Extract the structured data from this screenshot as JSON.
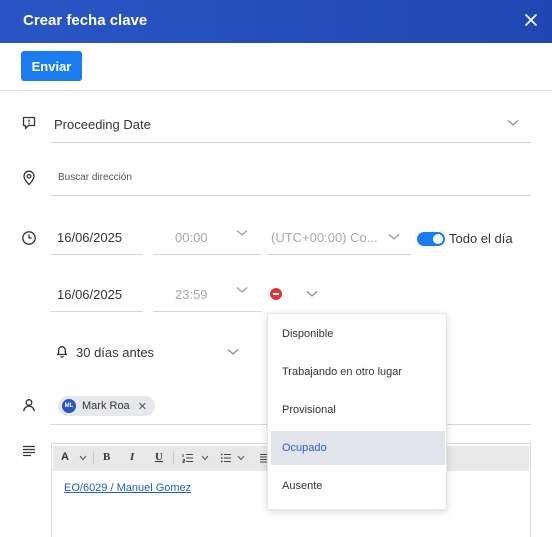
{
  "dialog": {
    "title": "Crear fecha clave"
  },
  "toolbar": {
    "send_label": "Enviar"
  },
  "form": {
    "event_type": "Proceeding Date",
    "address_placeholder": "Buscar dirección",
    "start_date": "16/06/2025",
    "start_time": "00:00",
    "timezone": "(UTC+00:00) Co...",
    "all_day_label": "Todo el día",
    "all_day": true,
    "end_date": "16/06/2025",
    "end_time": "23:59",
    "reminder": "30 días antes",
    "attendee": {
      "initials": "ML",
      "name": "Mark Roa"
    },
    "body_link": "EO/6029 / Manuel Gomez"
  },
  "availability_menu": {
    "items": [
      "Disponible",
      "Trabajando en otro lugar",
      "Provisional",
      "Ocupado",
      "Ausente"
    ],
    "selected": "Ocupado"
  },
  "editor_toolbar": {
    "font_label": "A",
    "bold": "B",
    "italic": "I",
    "underline": "U"
  },
  "colors": {
    "header": "#2a55c4",
    "accent": "#1b7cf0",
    "busy": "#d9363e",
    "selected_item_bg": "#e2e4ec",
    "selected_item_text": "#2a5fc8"
  }
}
